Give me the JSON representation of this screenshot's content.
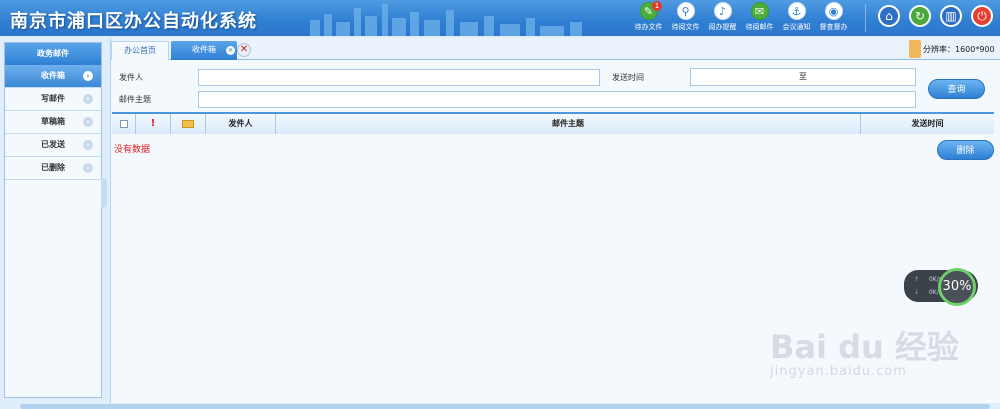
{
  "header": {
    "title": "南京市浦口区办公自动化系统",
    "tools": [
      {
        "label": "待办文件",
        "icon": "pen-icon",
        "badge": "1"
      },
      {
        "label": "待阅文件",
        "icon": "magnifier-icon"
      },
      {
        "label": "阅办提醒",
        "icon": "bell-icon"
      },
      {
        "label": "待阅邮件",
        "icon": "mail-icon"
      },
      {
        "label": "会议通知",
        "icon": "anchor-icon"
      },
      {
        "label": "督查督办",
        "icon": "eye-icon"
      }
    ],
    "actions": [
      {
        "name": "home-icon",
        "glyph": "⌂"
      },
      {
        "name": "refresh-icon",
        "glyph": "↻"
      },
      {
        "name": "book-icon",
        "glyph": "▥"
      },
      {
        "name": "power-icon",
        "glyph": "⏻"
      }
    ]
  },
  "sidebar": {
    "heading": "政务邮件",
    "items": [
      {
        "label": "收件箱",
        "active": true
      },
      {
        "label": "写邮件",
        "active": false
      },
      {
        "label": "草稿箱",
        "active": false
      },
      {
        "label": "已发送",
        "active": false
      },
      {
        "label": "已删除",
        "active": false
      }
    ]
  },
  "tabs": {
    "home": "办公首页",
    "inbox": "收件箱",
    "close_glyph": "✕"
  },
  "resolution": {
    "label": "分辨率：1600*900",
    "icon": "resolution-icon"
  },
  "search": {
    "sender_label": "发件人",
    "sender_value": "",
    "send_time_label": "发送时间",
    "date_separator": "至",
    "subject_label": "邮件主题",
    "subject_value": "",
    "query_button": "查询"
  },
  "table": {
    "columns": [
      "",
      "!",
      "",
      "发件人",
      "邮件主题",
      "发送时间"
    ],
    "empty_text": "没有数据",
    "delete_button": "删除"
  },
  "monitor": {
    "up": "0K/s",
    "down": "0K/s",
    "percent": "30%"
  },
  "watermark": {
    "logo": "Bai du 经验",
    "url": "jingyan.baidu.com"
  },
  "colors": {
    "header": "#2f7fd3",
    "accent": "#4d97de",
    "empty_text": "#e02020"
  }
}
